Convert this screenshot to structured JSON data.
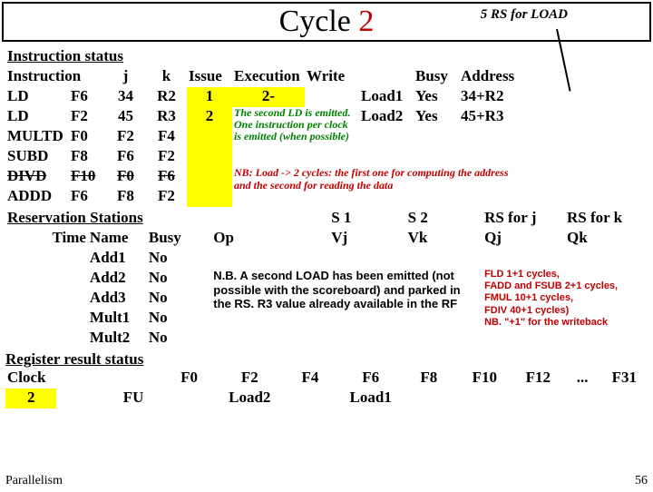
{
  "title": {
    "main": "Cycle",
    "num": "2",
    "annot": "5 RS for LOAD"
  },
  "instr_status": {
    "heading": "Instruction status",
    "cols": {
      "instr": "Instruction",
      "j": "j",
      "k": "k",
      "issue": "Issue",
      "exec": "Execution",
      "write": "Write",
      "busy": "Busy",
      "addr": "Address"
    },
    "rows": [
      {
        "op": "LD",
        "d": "F6",
        "j": "34",
        "k": "R2",
        "issue": "1",
        "exec": "2-",
        "load": "Load1",
        "busy": "Yes",
        "addr": "34+R2"
      },
      {
        "op": "LD",
        "d": "F2",
        "j": "45",
        "k": "R3",
        "issue": "2",
        "exec": "",
        "load": "Load2",
        "busy": "Yes",
        "addr": "45+R3"
      },
      {
        "op": "MULTD",
        "d": "F0",
        "j": "F2",
        "k": "F4",
        "issue": "",
        "exec": "",
        "load": "",
        "busy": "",
        "addr": ""
      },
      {
        "op": "SUBD",
        "d": "F8",
        "j": "F6",
        "k": "F2",
        "issue": "",
        "exec": "",
        "load": "",
        "busy": "",
        "addr": ""
      },
      {
        "op": "DIVD",
        "d": "F10",
        "j": "F0",
        "k": "F6",
        "issue": "",
        "exec": "",
        "load": "",
        "busy": "",
        "addr": "",
        "strike": true
      },
      {
        "op": "ADDD",
        "d": "F6",
        "j": "F8",
        "k": "F2",
        "issue": "",
        "exec": "",
        "load": "",
        "busy": "",
        "addr": ""
      }
    ],
    "green_note": "The second LD is emitted. One instruction per clock is emitted (when possible)",
    "red_note": "NB: Load -> 2 cycles: the first one for computing the address and the second for reading the data"
  },
  "res_stations": {
    "heading": "Reservation Stations",
    "cols": {
      "time": "Time",
      "name": "Name",
      "busy": "Busy",
      "op": "Op",
      "vj": "Vj",
      "vk": "Vk",
      "qj": "Qj",
      "qk": "Qk",
      "s1": "S 1",
      "s2": "S 2",
      "rsj": "RS for j",
      "rsk": "RS for k"
    },
    "rows": [
      {
        "name": "Add1",
        "busy": "No"
      },
      {
        "name": "Add2",
        "busy": "No"
      },
      {
        "name": "Add3",
        "busy": "No"
      },
      {
        "name": "Mult1",
        "busy": "No"
      },
      {
        "name": "Mult2",
        "busy": "No"
      }
    ],
    "nb_note": "N.B. A second LOAD has been emitted (not possible with the scoreboard) and parked in the RS. R3 value already available in the RF",
    "red_side": "FLD 1+1 cycles,\nFADD and FSUB 2+1 cycles,\nFMUL 10+1 cycles,\nFDIV 40+1 cycles)\nNB. \"+1\" for the writeback"
  },
  "reg_status": {
    "heading": "Register result status",
    "clock_label": "Clock",
    "clock_val": "2",
    "fu_label": "FU",
    "cols": [
      "F0",
      "F2",
      "F4",
      "F6",
      "F8",
      "F10",
      "F12",
      "...",
      "F31"
    ],
    "vals": [
      "",
      "Load2",
      "",
      "Load1",
      "",
      "",
      "",
      "",
      ""
    ]
  },
  "footer": {
    "left": "Parallelism",
    "right": "56"
  }
}
